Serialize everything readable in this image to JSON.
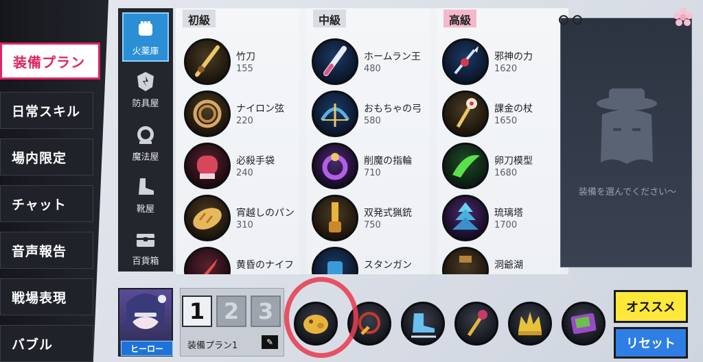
{
  "left_menu": {
    "items": [
      {
        "label": "装備プラン",
        "active": true
      },
      {
        "label": "日常スキル",
        "active": false
      },
      {
        "label": "場内限定",
        "active": false
      },
      {
        "label": "チャット",
        "active": false
      },
      {
        "label": "音声報告",
        "active": false
      },
      {
        "label": "戦場表現",
        "active": false
      },
      {
        "label": "バブル",
        "active": false
      }
    ]
  },
  "categories": [
    {
      "label": "火薬庫",
      "icon": "fist-icon",
      "active": true
    },
    {
      "label": "防具屋",
      "icon": "armor-icon",
      "active": false
    },
    {
      "label": "魔法屋",
      "icon": "orb-icon",
      "active": false
    },
    {
      "label": "靴屋",
      "icon": "boot-icon",
      "active": false
    },
    {
      "label": "百貨箱",
      "icon": "chest-icon",
      "active": false
    }
  ],
  "tiers": [
    {
      "label": "初級",
      "items": [
        {
          "name": "竹刀",
          "price": "155",
          "icon": "bamboo-sword-icon"
        },
        {
          "name": "ナイロン弦",
          "price": "220",
          "icon": "rope-icon"
        },
        {
          "name": "必殺手袋",
          "price": "240",
          "icon": "boxing-glove-icon"
        },
        {
          "name": "宵越しのパン",
          "price": "310",
          "icon": "bread-icon"
        },
        {
          "name": "黄昏のナイフ",
          "price": "",
          "icon": "knife-icon"
        }
      ]
    },
    {
      "label": "中級",
      "items": [
        {
          "name": "ホームラン王",
          "price": "480",
          "icon": "bat-icon"
        },
        {
          "name": "おもちゃの弓",
          "price": "580",
          "icon": "bow-icon"
        },
        {
          "name": "削魔の指輪",
          "price": "710",
          "icon": "ring-icon"
        },
        {
          "name": "双発式猟銃",
          "price": "750",
          "icon": "shotgun-icon"
        },
        {
          "name": "スタンガン",
          "price": "",
          "icon": "stungun-icon"
        }
      ]
    },
    {
      "label": "高級",
      "items": [
        {
          "name": "邪神の力",
          "price": "1620",
          "icon": "trident-icon"
        },
        {
          "name": "課金の杖",
          "price": "1650",
          "icon": "staff-icon"
        },
        {
          "name": "卵刀模型",
          "price": "1680",
          "icon": "green-blade-icon"
        },
        {
          "name": "琉璃塔",
          "price": "1700",
          "icon": "tower-icon"
        },
        {
          "name": "洞爺湖",
          "price": "",
          "icon": "wooden-sword-icon"
        }
      ]
    }
  ],
  "right_panel": {
    "message": "装備を選んでください～"
  },
  "hero": {
    "label": "ヒーロー"
  },
  "plans": {
    "numbers": [
      "1",
      "2",
      "3"
    ],
    "active_index": 0,
    "name": "装備プラン1",
    "edit_glyph": "✎"
  },
  "slots": [
    {
      "icon": "gold-pig-icon"
    },
    {
      "icon": "whip-icon"
    },
    {
      "icon": "skate-boot-icon"
    },
    {
      "icon": "gold-scepter-icon"
    },
    {
      "icon": "gold-crown-icon"
    },
    {
      "icon": "spellbook-icon"
    }
  ],
  "buttons": {
    "recommend": "オススメ",
    "reset": "リセット"
  }
}
